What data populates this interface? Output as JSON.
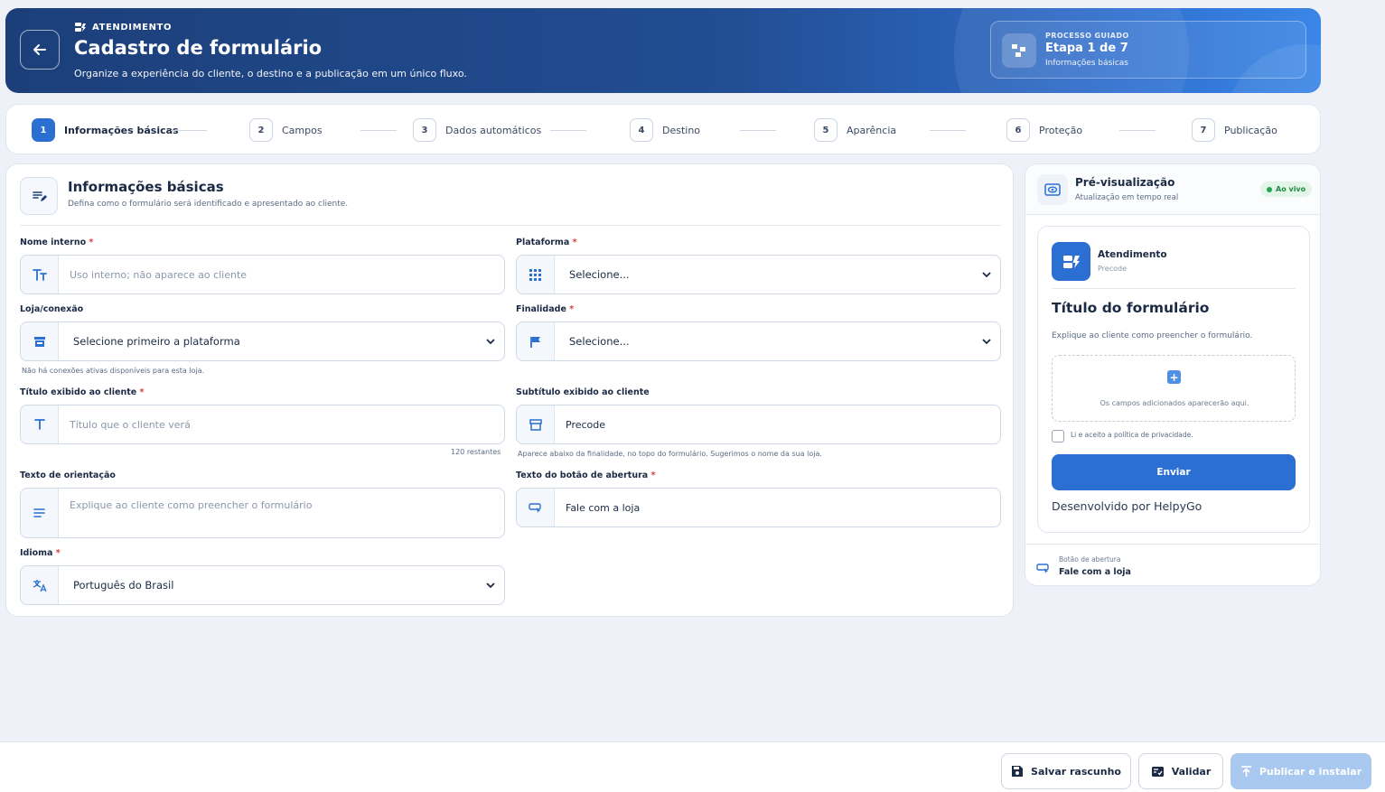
{
  "header": {
    "eyebrow": "ATENDIMENTO",
    "title": "Cadastro de formulário",
    "subtitle": "Organize a experiência do cliente, o destino e a publicação em um único fluxo.",
    "guide_label": "PROCESSO GUIADO",
    "guide_step": "Etapa 1 de 7",
    "guide_name": "Informações básicas"
  },
  "steps": [
    {
      "num": "1",
      "label": "Informações básicas"
    },
    {
      "num": "2",
      "label": "Campos"
    },
    {
      "num": "3",
      "label": "Dados automáticos"
    },
    {
      "num": "4",
      "label": "Destino"
    },
    {
      "num": "5",
      "label": "Aparência"
    },
    {
      "num": "6",
      "label": "Proteção"
    },
    {
      "num": "7",
      "label": "Publicação"
    }
  ],
  "form": {
    "title": "Informações básicas",
    "subtitle": "Defina como o formulário será identificado e apresentado ao cliente.",
    "required_mark": "*",
    "internal_name": {
      "label": "Nome interno",
      "placeholder": "Uso interno; não aparece ao cliente"
    },
    "platform": {
      "label": "Plataforma",
      "value": "Selecione..."
    },
    "store": {
      "label": "Loja/conexão",
      "value": "Selecione primeiro a plataforma",
      "hint": "Não há conexões ativas disponíveis para esta loja."
    },
    "purpose": {
      "label": "Finalidade",
      "value": "Selecione..."
    },
    "client_title": {
      "label": "Título exibido ao cliente",
      "placeholder": "Título que o cliente verá",
      "counter": "120 restantes"
    },
    "client_subtitle": {
      "label": "Subtítulo exibido ao cliente",
      "value": "Precode",
      "hint": "Aparece abaixo da finalidade, no topo do formulário. Sugerimos o nome da sua loja."
    },
    "guidance": {
      "label": "Texto de orientação",
      "placeholder": "Explique ao cliente como preencher o formulário"
    },
    "open_button": {
      "label": "Texto do botão de abertura",
      "value": "Fale com a loja"
    },
    "language": {
      "label": "Idioma",
      "value": "Português do Brasil"
    }
  },
  "preview": {
    "title": "Pré-visualização",
    "subtitle": "Atualização em tempo real",
    "live": "Ao vivo",
    "brand": "Atendimento",
    "brand_sub": "Precode",
    "form_title": "Título do formulário",
    "form_desc": "Explique ao cliente como preencher o formulário.",
    "drop_text": "Os campos adicionados aparecerão aqui.",
    "privacy": "Li e aceito a política de privacidade.",
    "send": "Enviar",
    "developed": "Desenvolvido por HelpyGo",
    "foot_label": "Botão de abertura",
    "foot_value": "Fale com a loja"
  },
  "actions": {
    "save_draft": "Salvar rascunho",
    "validate": "Validar",
    "publish": "Publicar e instalar"
  },
  "colors": {
    "accent": "#2b6fd2",
    "header_dark": "#1c3f7a",
    "live_green": "#22a652",
    "required_red": "#d83a3a"
  }
}
